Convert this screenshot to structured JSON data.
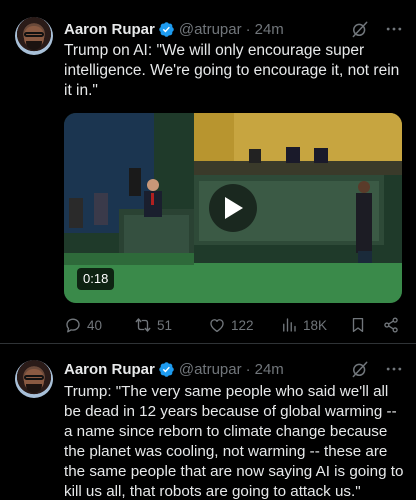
{
  "tweets": [
    {
      "author_name": "Aaron Rupar",
      "handle": "@atrupar",
      "dot": "·",
      "time": "24m",
      "text": "Trump on AI: \"We will only encourage super intelligence. We're going to encourage it, not rein it in.\"",
      "video_duration": "0:18",
      "replies": "40",
      "reposts": "51",
      "likes": "122",
      "views": "18K"
    },
    {
      "author_name": "Aaron Rupar",
      "handle": "@atrupar",
      "dot": "·",
      "time": "24m",
      "text": "Trump: \"The very same people who said we'll all be dead in 12 years because of global warming -- a name since reborn to climate change because the planet was cooling, not warming -- these are the same people that are now saying AI is going to kill us all, that robots are going to attack us.\""
    }
  ],
  "icons": {
    "verified": "verified-badge-icon",
    "grok": "grok-icon",
    "more": "more-icon",
    "reply": "reply-icon",
    "repost": "repost-icon",
    "like": "heart-icon",
    "views": "views-icon",
    "bookmark": "bookmark-icon",
    "share": "share-icon"
  },
  "colors": {
    "background": "#000000",
    "text": "#e7e9ea",
    "muted": "#71767b",
    "verified": "#1d9bf0",
    "divider": "#2f3336"
  }
}
